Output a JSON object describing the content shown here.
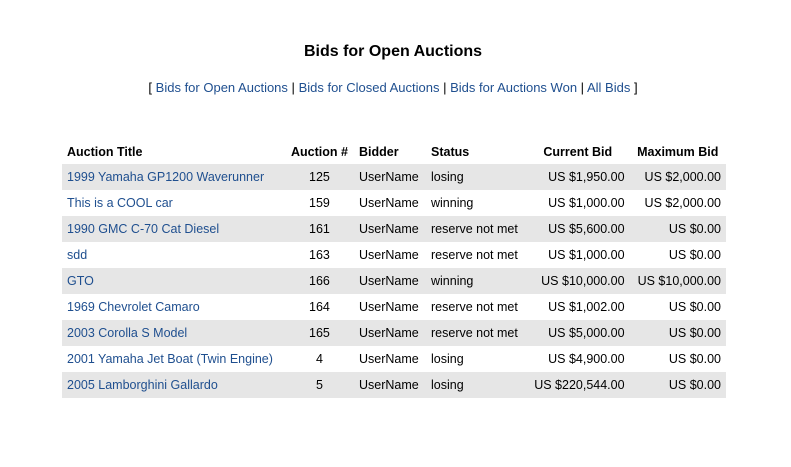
{
  "page": {
    "title": "Bids for Open Auctions"
  },
  "nav": {
    "open_bracket": "[",
    "close_bracket": "]",
    "separator": "|",
    "links": [
      {
        "label": "Bids for Open Auctions"
      },
      {
        "label": "Bids for Closed Auctions"
      },
      {
        "label": "Bids for Auctions Won"
      },
      {
        "label": "All Bids"
      }
    ]
  },
  "table": {
    "headers": {
      "title": "Auction Title",
      "number": "Auction #",
      "bidder": "Bidder",
      "status": "Status",
      "current_bid": "Current Bid",
      "max_bid": "Maximum Bid"
    },
    "rows": [
      {
        "title": "1999 Yamaha GP1200 Waverunner",
        "number": "125",
        "bidder": "UserName",
        "status": "losing",
        "current_bid": "US $1,950.00",
        "max_bid": "US $2,000.00"
      },
      {
        "title": "This is a COOL car",
        "number": "159",
        "bidder": "UserName",
        "status": "winning",
        "current_bid": "US $1,000.00",
        "max_bid": "US $2,000.00"
      },
      {
        "title": "1990 GMC C-70 Cat Diesel",
        "number": "161",
        "bidder": "UserName",
        "status": "reserve not met",
        "current_bid": "US $5,600.00",
        "max_bid": "US $0.00"
      },
      {
        "title": "sdd",
        "number": "163",
        "bidder": "UserName",
        "status": "reserve not met",
        "current_bid": "US $1,000.00",
        "max_bid": "US $0.00"
      },
      {
        "title": "GTO",
        "number": "166",
        "bidder": "UserName",
        "status": "winning",
        "current_bid": "US $10,000.00",
        "max_bid": "US $10,000.00"
      },
      {
        "title": "1969 Chevrolet Camaro",
        "number": "164",
        "bidder": "UserName",
        "status": "reserve not met",
        "current_bid": "US $1,002.00",
        "max_bid": "US $0.00"
      },
      {
        "title": "2003 Corolla S Model",
        "number": "165",
        "bidder": "UserName",
        "status": "reserve not met",
        "current_bid": "US $5,000.00",
        "max_bid": "US $0.00"
      },
      {
        "title": "2001 Yamaha Jet Boat (Twin Engine)",
        "number": "4",
        "bidder": "UserName",
        "status": "losing",
        "current_bid": "US $4,900.00",
        "max_bid": "US $0.00"
      },
      {
        "title": "2005 Lamborghini Gallardo",
        "number": "5",
        "bidder": "UserName",
        "status": "losing",
        "current_bid": "US $220,544.00",
        "max_bid": "US $0.00"
      }
    ]
  },
  "colors": {
    "link": "#1f4f8f",
    "row_shade": "#e6e6e6",
    "text": "#000000"
  }
}
